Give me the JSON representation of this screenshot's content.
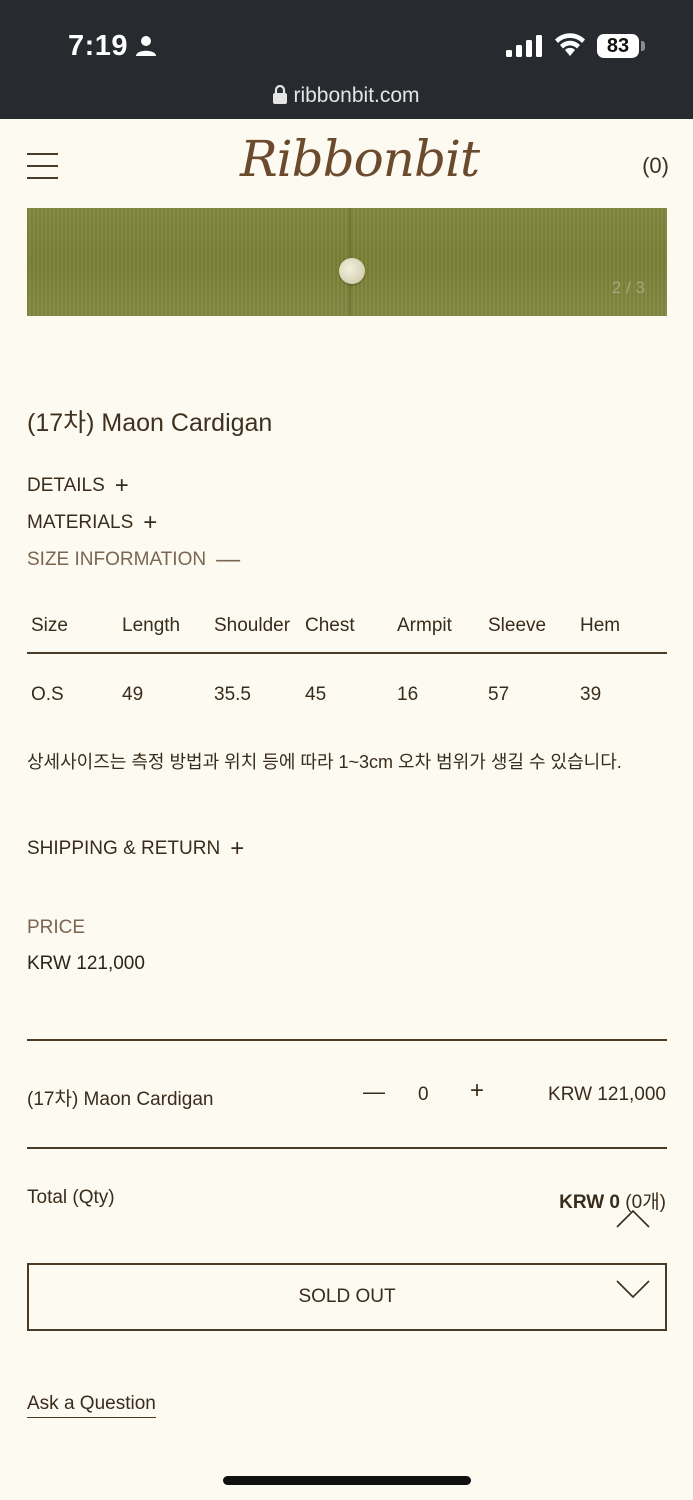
{
  "status_bar": {
    "time": "7:19",
    "battery": "83",
    "url": "ribbonbit.com"
  },
  "header": {
    "logo": "Ribbonbit",
    "cart_count": "(0)"
  },
  "gallery": {
    "counter": "2 / 3"
  },
  "product": {
    "title": "(17차) Maon Cardigan",
    "accordions": [
      {
        "label": "DETAILS",
        "sign": "+"
      },
      {
        "label": "MATERIALS",
        "sign": "+"
      },
      {
        "label": "SIZE INFORMATION",
        "sign": "—"
      },
      {
        "label": "SHIPPING & RETURN",
        "sign": "+"
      }
    ],
    "size_table": {
      "headers": [
        "Size",
        "Length",
        "Shoulder",
        "Chest",
        "Armpit",
        "Sleeve",
        "Hem"
      ],
      "rows": [
        [
          "O.S",
          "49",
          "35.5",
          "45",
          "16",
          "57",
          "39"
        ]
      ]
    },
    "size_note": "상세사이즈는 측정 방법과 위치 등에 따라 1~3cm 오차 범위가 생길 수 있습니다.",
    "price_label": "PRICE",
    "price": "KRW 121,000"
  },
  "option": {
    "name": "(17차) Maon Cardigan",
    "minus": "—",
    "quantity": "0",
    "plus": "+",
    "price": "KRW 121,000"
  },
  "total": {
    "label": "Total (Qty)",
    "amount": "KRW 0",
    "qty": "(0개)"
  },
  "actions": {
    "sold_out": "SOLD OUT",
    "ask": "Ask a Question"
  },
  "colors": {
    "background": "#fdfbf1",
    "brand": "#6b4a2e",
    "line": "#4a3a26",
    "statusbar": "#272a2f"
  }
}
